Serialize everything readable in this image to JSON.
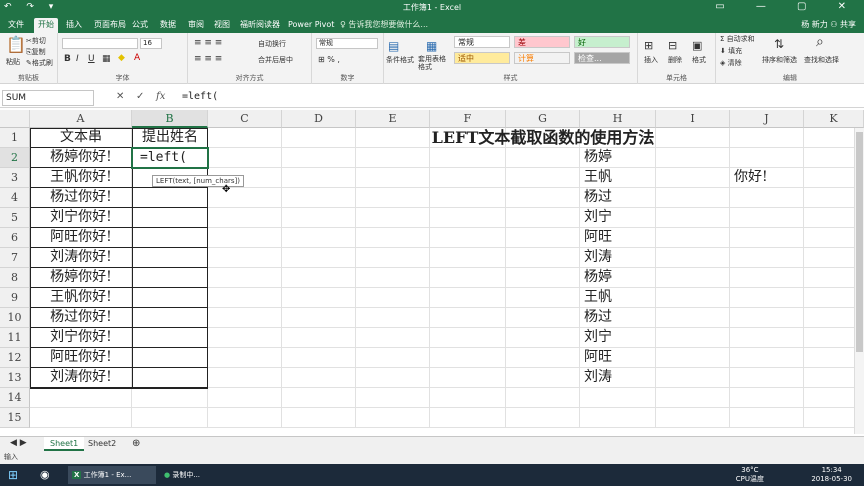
{
  "titlebar": {
    "title": "工作簿1 - Excel",
    "qat": "↶ ↷ ▾",
    "winctl": "▭ — ▢ ✕"
  },
  "tabs": [
    "文件",
    "开始",
    "插入",
    "页面布局",
    "公式",
    "数据",
    "审阅",
    "视图",
    "福昕阅读器",
    "Power Pivot"
  ],
  "tell_me": "告诉我您想要做什么...",
  "user": "杨 新力  ⚇ 共享",
  "ribbon": {
    "clipboard": {
      "label": "剪贴板",
      "paste": "粘贴",
      "cut": "剪切",
      "copy": "复制",
      "painter": "格式刷"
    },
    "font": {
      "label": "字体",
      "font_name": "",
      "font_size": "16",
      "bold": "B",
      "italic": "I",
      "underline": "U"
    },
    "align": {
      "label": "对齐方式",
      "wrap": "自动换行",
      "merge": "合并后居中"
    },
    "number": {
      "label": "数字",
      "format": "常规"
    },
    "styles": {
      "label": "样式",
      "cond": "条件格式",
      "table": "套用表格格式",
      "normal": "常规",
      "bad": "差",
      "good": "好",
      "neutral": "适中",
      "calc": "计算",
      "check": "检查..."
    },
    "cells": {
      "label": "单元格",
      "insert": "插入",
      "delete": "删除",
      "format": "格式"
    },
    "editing": {
      "label": "编辑",
      "autosum": "Σ 自动求和",
      "fill": "填充",
      "clear": "清除",
      "sort": "排序和筛选",
      "find": "查找和选择"
    }
  },
  "formula_bar": {
    "name_box": "SUM",
    "cancel": "✕",
    "enter": "✓",
    "fx": "fx",
    "content": "=left("
  },
  "columns": [
    "A",
    "B",
    "C",
    "D",
    "E",
    "F",
    "G",
    "H",
    "I",
    "J",
    "K"
  ],
  "rows": [
    "1",
    "2",
    "3",
    "4",
    "5",
    "6",
    "7",
    "8",
    "9",
    "10",
    "11",
    "12",
    "13",
    "14",
    "15"
  ],
  "cells": {
    "A1": "文本串",
    "B1": "提出姓名",
    "A2": "杨婷你好!",
    "A3": "王帆你好!",
    "A4": "杨过你好!",
    "A5": "刘宁你好!",
    "A6": "阿旺你好!",
    "A7": "刘涛你好!",
    "A8": "杨婷你好!",
    "A9": "王帆你好!",
    "A10": "杨过你好!",
    "A11": "刘宁你好!",
    "A12": "阿旺你好!",
    "A13": "刘涛你好!",
    "B2": "=left(",
    "E1": "LEFT文本截取函数的使用方法",
    "H2": "杨婷",
    "H3": "王帆",
    "H4": "杨过",
    "H5": "刘宁",
    "H6": "阿旺",
    "H7": "刘涛",
    "H8": "杨婷",
    "H9": "王帆",
    "H10": "杨过",
    "H11": "刘宁",
    "H12": "阿旺",
    "H13": "刘涛",
    "J3": "你好!"
  },
  "tooltip": "LEFT(text, [num_chars])",
  "sheets": [
    "Sheet1",
    "Sheet2"
  ],
  "status": "输入",
  "taskbar": {
    "excel": "工作簿1 - Ex...",
    "rec": "录制中...",
    "temp": "36°C",
    "cpu": "CPU温度",
    "time": "15:34",
    "date": "2018-05-30"
  }
}
